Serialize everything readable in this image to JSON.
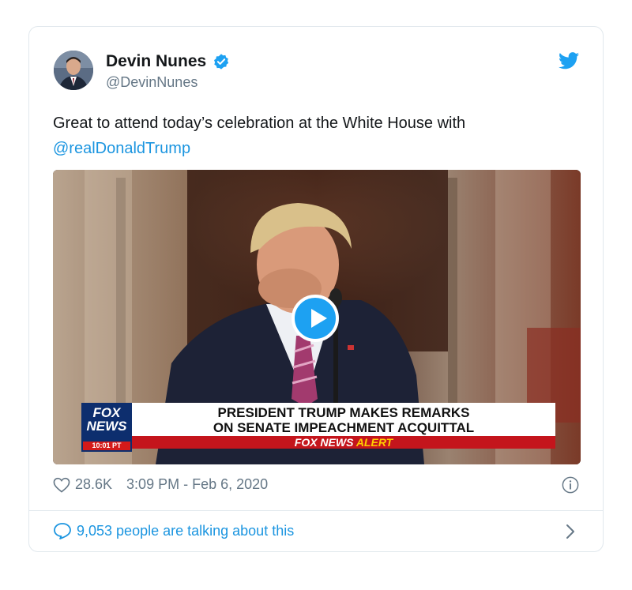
{
  "author": {
    "name": "Devin Nunes",
    "handle": "@DevinNunes"
  },
  "tweet": {
    "text": "Great to attend today’s celebration at the White House with ",
    "mention": "@realDonaldTrump"
  },
  "video": {
    "logo_line1": "FOX",
    "logo_line2": "NEWS",
    "logo_time": "10:01 PT",
    "headline_line1": "PRESIDENT TRUMP MAKES REMARKS",
    "headline_line2": "ON SENATE IMPEACHMENT ACQUITTAL",
    "alert_prefix": "FOX NEWS",
    "alert_suffix": "ALERT"
  },
  "meta": {
    "likes": "28.6K",
    "timestamp": "3:09 PM - Feb 6, 2020"
  },
  "footer": {
    "talking": "9,053 people are talking about this"
  },
  "colors": {
    "accent": "#1da1f2",
    "link": "#1b95e0",
    "muted": "#657786",
    "border": "#e1e8ed"
  },
  "icons": [
    "verified-badge-icon",
    "twitter-bird-icon",
    "play-icon",
    "heart-icon",
    "info-icon",
    "comment-bubble-icon",
    "chevron-right-icon"
  ]
}
